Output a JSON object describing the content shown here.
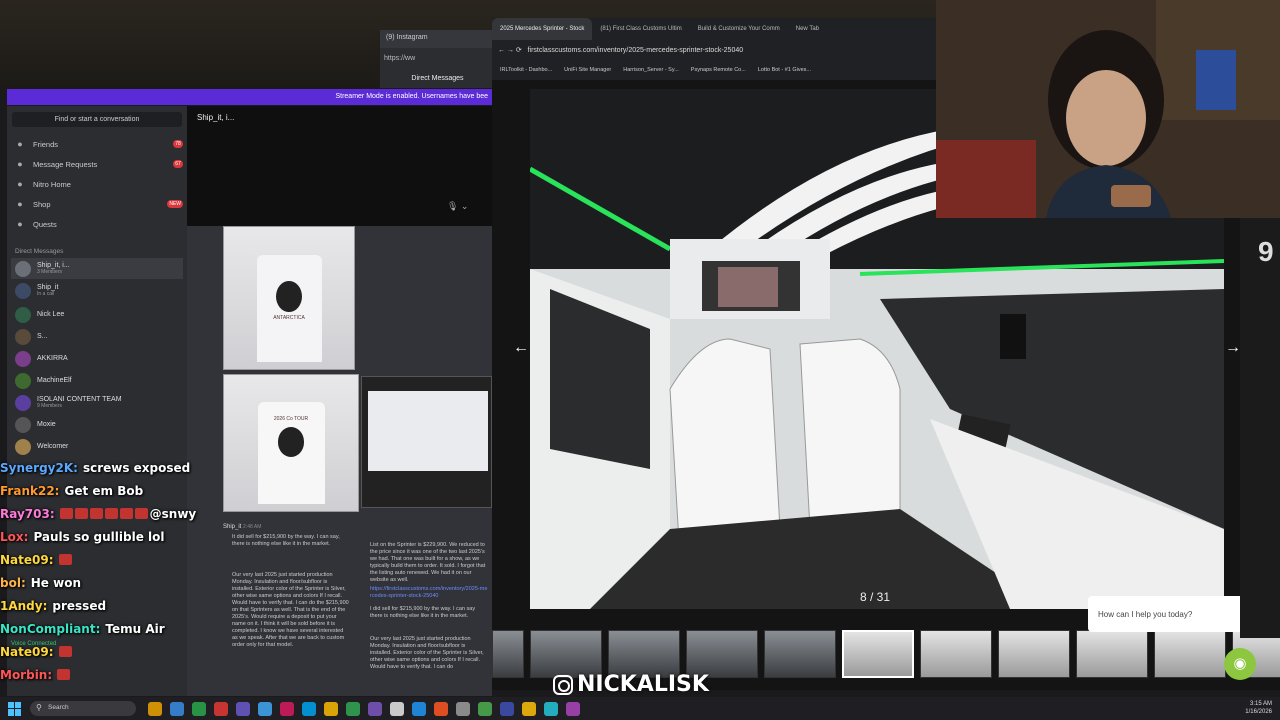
{
  "instagram": {
    "tab_title": "(9) Instagram",
    "url": "https://ww",
    "header": "Direct Messages"
  },
  "banner": {
    "text": "Streamer Mode is enabled. Usernames have bee"
  },
  "discord": {
    "find_placeholder": "Find or start a conversation",
    "nav": [
      {
        "label": "Friends",
        "icon": "friends-icon",
        "badge": "78"
      },
      {
        "label": "Message Requests",
        "icon": "mail-icon",
        "badge": "67"
      },
      {
        "label": "Nitro Home",
        "icon": "nitro-icon",
        "badge": ""
      },
      {
        "label": "Shop",
        "icon": "shop-icon",
        "badge": "NEW"
      },
      {
        "label": "Quests",
        "icon": "quests-icon",
        "badge": ""
      }
    ],
    "dm_header": "Direct Messages",
    "dms": [
      {
        "name": "Ship_it, i...",
        "sub": "3 Members",
        "color": "#6b6f78"
      },
      {
        "name": "Ship_it",
        "sub": "In a call",
        "color": "#3d4a66"
      },
      {
        "name": "Nick Lee",
        "sub": "",
        "color": "#2f5d45"
      },
      {
        "name": "S...",
        "sub": "",
        "color": "#5a4a3a"
      },
      {
        "name": "AKKIRRA",
        "sub": "",
        "color": "#7a3e8a"
      },
      {
        "name": "MachineElf",
        "sub": "",
        "color": "#3f6a2f"
      },
      {
        "name": "ISOLANI CONTENT TEAM",
        "sub": "9 Members",
        "color": "#5b3fa0"
      },
      {
        "name": "Moxie",
        "sub": "",
        "color": "#555"
      },
      {
        "name": "Welcomer",
        "sub": "",
        "color": "#a0804b"
      }
    ],
    "chat_title": "Ship_it, i...",
    "shirt_text": "ANTARCTICA",
    "shirt_tour": "2026 Co TOUR",
    "sender": "Ship_it",
    "sent_time": "2:48 AM",
    "msg1": "It did sell for $215,900 by the way. I can say, there is nothing else like it in the market.",
    "msg2": "Our very last 2025 just started production Monday. Insulation and floor/subfloor is installed. Exterior color of the Sprinter is Silver, other wise same options and colors If I recall. Would have to verify that. I can do the $215,900 on that Sprinters as well. That is the end of the 2025's. Would require a deposit to put your name on it. I think it will be sold before it is completed. I know we have several interested as we speak. After that we are back to custom order only for that model.",
    "msg3": "List on the Sprinter is $229,900. We reduced to the price since it was one of the two last 2025's we had. That one was built for a show, as we typically build them to order. It sold. I forgot that the listing auto renewed. We had it on our website as well.",
    "msg3_link": "https://firstclasscustoms.com/inventory/2025-mercedes-sprinter-stock-25040",
    "msg4": "I did sell for $215,900 by the way. I can say there is nothing else like it in the market.",
    "msg5": "Our very last 2025 just started production Monday. Insulation and floor/subfloor is installed. Exterior color of the Sprinter is Silver, other wise same options and colors If I recall. Would have to verify that. I can do",
    "voice_status": "Voice Connected"
  },
  "chat_overlay": [
    {
      "user": "Synergy2K:",
      "color": "#5aa9ff",
      "text": "screws exposed",
      "emotes": 0
    },
    {
      "user": "Frank22:",
      "color": "#ff9a2e",
      "text": "Get em Bob",
      "emotes": 0
    },
    {
      "user": "Ray703:",
      "color": "#ff7ad9",
      "text": "@snwy",
      "emotes": 6
    },
    {
      "user": "Lox:",
      "color": "#ff5555",
      "text": "Pauls so gullible lol",
      "emotes": 0
    },
    {
      "user": "Nate09:",
      "color": "#ffd83d",
      "text": "",
      "emotes": 1
    },
    {
      "user": "bol:",
      "color": "#ffb347",
      "text": "He won",
      "emotes": 0
    },
    {
      "user": "1Andy:",
      "color": "#ffd83d",
      "text": "pressed",
      "emotes": 0
    },
    {
      "user": "NonCompliant:",
      "color": "#38e6c5",
      "text": "Temu Air",
      "emotes": 0
    },
    {
      "user": "Nate09:",
      "color": "#ffd83d",
      "text": "",
      "emotes": 1
    },
    {
      "user": "Morbin:",
      "color": "#ff5555",
      "text": "",
      "emotes": 1
    }
  ],
  "browser": {
    "tabs": [
      {
        "label": "2025 Mercedes Sprinter - Stock",
        "active": true
      },
      {
        "label": "(81) First Class Customs Ultim",
        "active": false
      },
      {
        "label": "Build & Customize Your Comm",
        "active": false
      },
      {
        "label": "New Tab",
        "active": false
      }
    ],
    "url": "firstclasscustoms.com/inventory/2025-mercedes-sprinter-stock-25040",
    "bookmarks": [
      "IRLToolkit - Dashbo...",
      "UniFi Site Manager",
      "Harrison_Server - Sy...",
      "Psynaps Remote Co...",
      "Lotto Bot - #1 Gives..."
    ]
  },
  "gallery": {
    "counter": "8 / 31",
    "prev_icon": "chevron-left-icon",
    "next_icon": "chevron-right-icon",
    "thumb_count": 11,
    "selected_thumb": 5,
    "help_text": "How can I help you today?"
  },
  "side_number": "9",
  "watermark": {
    "handle": "NICKALISK"
  },
  "taskbar": {
    "search": "Search",
    "time": "3:15 AM",
    "date": "1/16/2026"
  }
}
